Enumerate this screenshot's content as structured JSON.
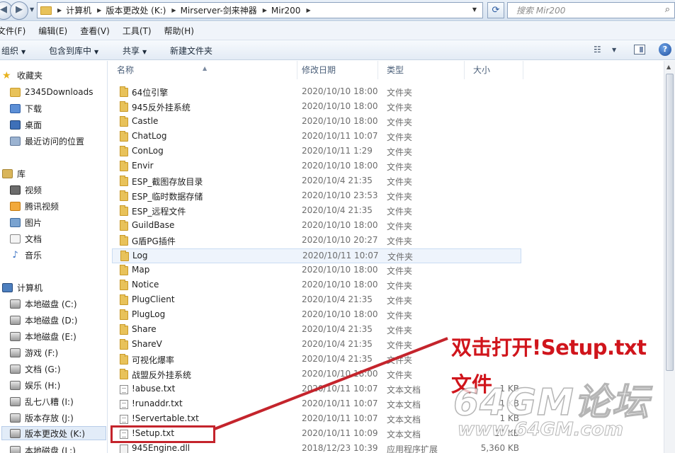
{
  "address_bar": {
    "crumbs": [
      "计算机",
      "版本更改处 (K:)",
      "Mirserver-剑来神器",
      "Mir200"
    ],
    "search_placeholder": "搜索 Mir200"
  },
  "menu": [
    "文件(F)",
    "编辑(E)",
    "查看(V)",
    "工具(T)",
    "帮助(H)"
  ],
  "toolbar": {
    "organize": "组织",
    "include_in_library": "包含到库中",
    "share": "共享",
    "new_folder": "新建文件夹"
  },
  "nav": {
    "favorites": "收藏夹",
    "favorites_items": [
      "2345Downloads",
      "下载",
      "桌面",
      "最近访问的位置"
    ],
    "libraries": "库",
    "library_items": [
      "视频",
      "腾讯视频",
      "图片",
      "文档",
      "音乐"
    ],
    "computer": "计算机",
    "drives": [
      "本地磁盘 (C:)",
      "本地磁盘 (D:)",
      "本地磁盘 (E:)",
      "游戏 (F:)",
      "文档 (G:)",
      "娱乐 (H:)",
      "乱七八糟 (I:)",
      "版本存放 (J:)",
      "版本更改处 (K:)",
      "本地磁盘 (L:)"
    ]
  },
  "columns": {
    "name": "名称",
    "date": "修改日期",
    "type": "类型",
    "size": "大小"
  },
  "files": [
    {
      "name": "64位引擎",
      "date": "2020/10/10 18:00",
      "type": "文件夹",
      "size": "",
      "kind": "folder"
    },
    {
      "name": "945反外挂系统",
      "date": "2020/10/10 18:00",
      "type": "文件夹",
      "size": "",
      "kind": "folder"
    },
    {
      "name": "Castle",
      "date": "2020/10/10 18:00",
      "type": "文件夹",
      "size": "",
      "kind": "folder"
    },
    {
      "name": "ChatLog",
      "date": "2020/10/11 10:07",
      "type": "文件夹",
      "size": "",
      "kind": "folder"
    },
    {
      "name": "ConLog",
      "date": "2020/10/11 1:29",
      "type": "文件夹",
      "size": "",
      "kind": "folder"
    },
    {
      "name": "Envir",
      "date": "2020/10/10 18:00",
      "type": "文件夹",
      "size": "",
      "kind": "folder"
    },
    {
      "name": "ESP_截图存放目录",
      "date": "2020/10/4 21:35",
      "type": "文件夹",
      "size": "",
      "kind": "folder"
    },
    {
      "name": "ESP_临时数据存储",
      "date": "2020/10/10 23:53",
      "type": "文件夹",
      "size": "",
      "kind": "folder"
    },
    {
      "name": "ESP_远程文件",
      "date": "2020/10/4 21:35",
      "type": "文件夹",
      "size": "",
      "kind": "folder"
    },
    {
      "name": "GuildBase",
      "date": "2020/10/10 18:00",
      "type": "文件夹",
      "size": "",
      "kind": "folder"
    },
    {
      "name": "G盾PG插件",
      "date": "2020/10/10 20:27",
      "type": "文件夹",
      "size": "",
      "kind": "folder"
    },
    {
      "name": "Log",
      "date": "2020/10/11 10:07",
      "type": "文件夹",
      "size": "",
      "kind": "folder"
    },
    {
      "name": "Map",
      "date": "2020/10/10 18:00",
      "type": "文件夹",
      "size": "",
      "kind": "folder"
    },
    {
      "name": "Notice",
      "date": "2020/10/10 18:00",
      "type": "文件夹",
      "size": "",
      "kind": "folder"
    },
    {
      "name": "PlugClient",
      "date": "2020/10/4 21:35",
      "type": "文件夹",
      "size": "",
      "kind": "folder"
    },
    {
      "name": "PlugLog",
      "date": "2020/10/10 18:00",
      "type": "文件夹",
      "size": "",
      "kind": "folder"
    },
    {
      "name": "Share",
      "date": "2020/10/4 21:35",
      "type": "文件夹",
      "size": "",
      "kind": "folder"
    },
    {
      "name": "ShareV",
      "date": "2020/10/4 21:35",
      "type": "文件夹",
      "size": "",
      "kind": "folder"
    },
    {
      "name": "可视化爆率",
      "date": "2020/10/4 21:35",
      "type": "文件夹",
      "size": "",
      "kind": "folder"
    },
    {
      "name": "战盟反外挂系统",
      "date": "2020/10/10 18:00",
      "type": "文件夹",
      "size": "",
      "kind": "folder"
    },
    {
      "name": "!abuse.txt",
      "date": "2020/10/11 10:07",
      "type": "文本文档",
      "size": "1 KB",
      "kind": "txt"
    },
    {
      "name": "!runaddr.txt",
      "date": "2020/10/11 10:07",
      "type": "文本文档",
      "size": "1 KB",
      "kind": "txt"
    },
    {
      "name": "!Servertable.txt",
      "date": "2020/10/11 10:07",
      "type": "文本文档",
      "size": "1 KB",
      "kind": "txt"
    },
    {
      "name": "!Setup.txt",
      "date": "2020/10/11 10:09",
      "type": "文本文档",
      "size": "17 KB",
      "kind": "txt"
    },
    {
      "name": "945Engine.dll",
      "date": "2018/12/23 10:39",
      "type": "应用程序扩展",
      "size": "5,360 KB",
      "kind": "dll"
    }
  ],
  "annotation": {
    "line1": "双击打开!Setup.txt",
    "line2": "文件",
    "color": "#d0151c"
  },
  "watermark": {
    "line1": "64GM论坛",
    "line2": "www.64GM.com"
  }
}
